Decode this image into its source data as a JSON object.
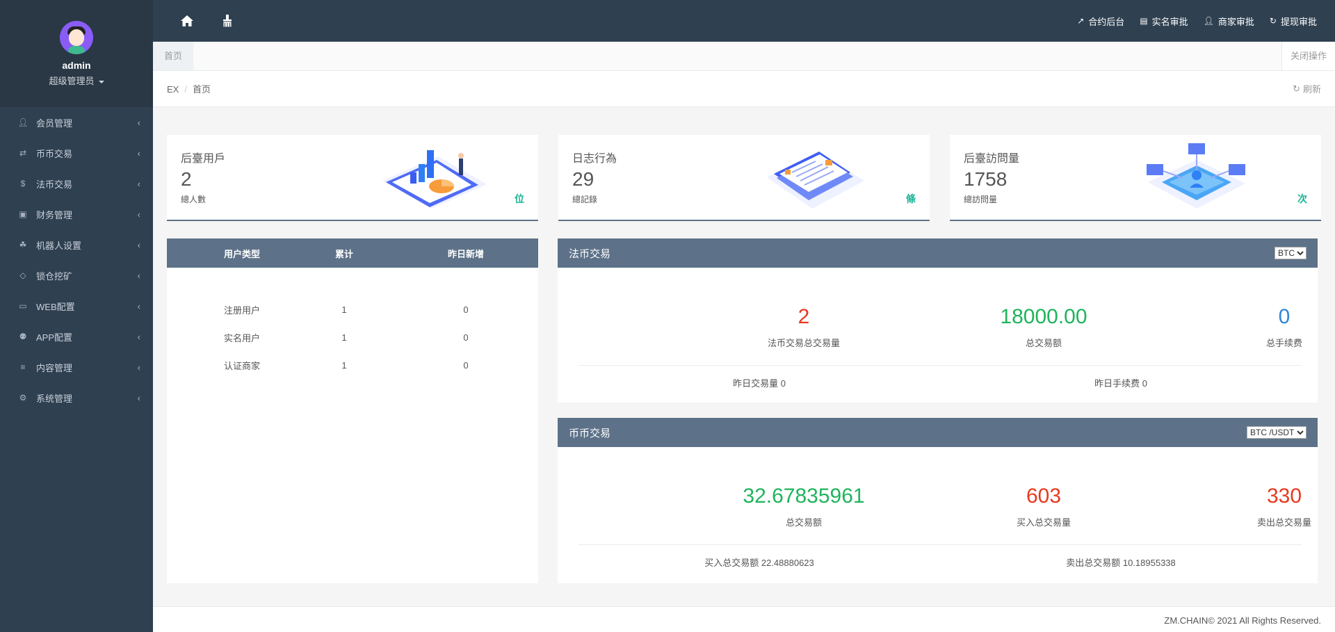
{
  "profile": {
    "name": "admin",
    "role": "超级管理员"
  },
  "sidebar": {
    "items": [
      {
        "icon": "user-icon",
        "label": "会员管理"
      },
      {
        "icon": "exchange-icon",
        "label": "币币交易"
      },
      {
        "icon": "dollar-icon",
        "label": "法币交易"
      },
      {
        "icon": "money-icon",
        "label": "财务管理"
      },
      {
        "icon": "paw-icon",
        "label": "机器人设置"
      },
      {
        "icon": "diamond-icon",
        "label": "锁仓挖矿"
      },
      {
        "icon": "laptop-icon",
        "label": "WEB配置"
      },
      {
        "icon": "android-icon",
        "label": "APP配置"
      },
      {
        "icon": "list-icon",
        "label": "内容管理"
      },
      {
        "icon": "cogs-icon",
        "label": "系统管理"
      }
    ]
  },
  "topbar": {
    "links": [
      {
        "icon": "external-link-icon",
        "label": "合约后台"
      },
      {
        "icon": "id-card-icon",
        "label": "实名审批"
      },
      {
        "icon": "user-icon",
        "label": "商家审批"
      },
      {
        "icon": "retweet-icon",
        "label": "提现审批"
      }
    ]
  },
  "tabs": {
    "home": "首页",
    "close_ops": "关闭操作"
  },
  "breadcrumb": {
    "root": "EX",
    "current": "首页",
    "refresh": "刷新"
  },
  "stats": [
    {
      "title": "后臺用戶",
      "value": "2",
      "sub": "總人數",
      "unit": "位"
    },
    {
      "title": "日志行為",
      "value": "29",
      "sub": "總記錄",
      "unit": "條"
    },
    {
      "title": "后臺訪問量",
      "value": "1758",
      "sub": "總訪問量",
      "unit": "次"
    }
  ],
  "user_table": {
    "headers": [
      "用户类型",
      "累计",
      "昨日新增"
    ],
    "rows": [
      [
        "注册用户",
        "1",
        "0"
      ],
      [
        "实名用户",
        "1",
        "0"
      ],
      [
        "认证商家",
        "1",
        "0"
      ]
    ]
  },
  "fiat": {
    "title": "法币交易",
    "select": "BTC",
    "metrics": [
      {
        "value": "2",
        "label": "法币交易总交易量",
        "color": "#e7391f"
      },
      {
        "value": "18000.00",
        "label": "总交易额",
        "color": "#1fb45c"
      },
      {
        "value": "0",
        "label": "总手续费",
        "color": "#2f86d8"
      }
    ],
    "foot_left": "昨日交易量 0",
    "foot_right": "昨日手续费 0"
  },
  "coin": {
    "title": "币币交易",
    "select": "BTC /USDT",
    "metrics": [
      {
        "value": "32.67835961",
        "label": "总交易额",
        "color": "#1fb45c"
      },
      {
        "value": "603",
        "label": "买入总交易量",
        "color": "#e7391f"
      },
      {
        "value": "330",
        "label": "卖出总交易量",
        "color": "#e7391f"
      }
    ],
    "foot_left": "买入总交易额 22.48880623",
    "foot_right": "卖出总交易额 10.18955338"
  },
  "footer": {
    "text": "ZM.CHAIN© 2021 All Rights Reserved."
  }
}
